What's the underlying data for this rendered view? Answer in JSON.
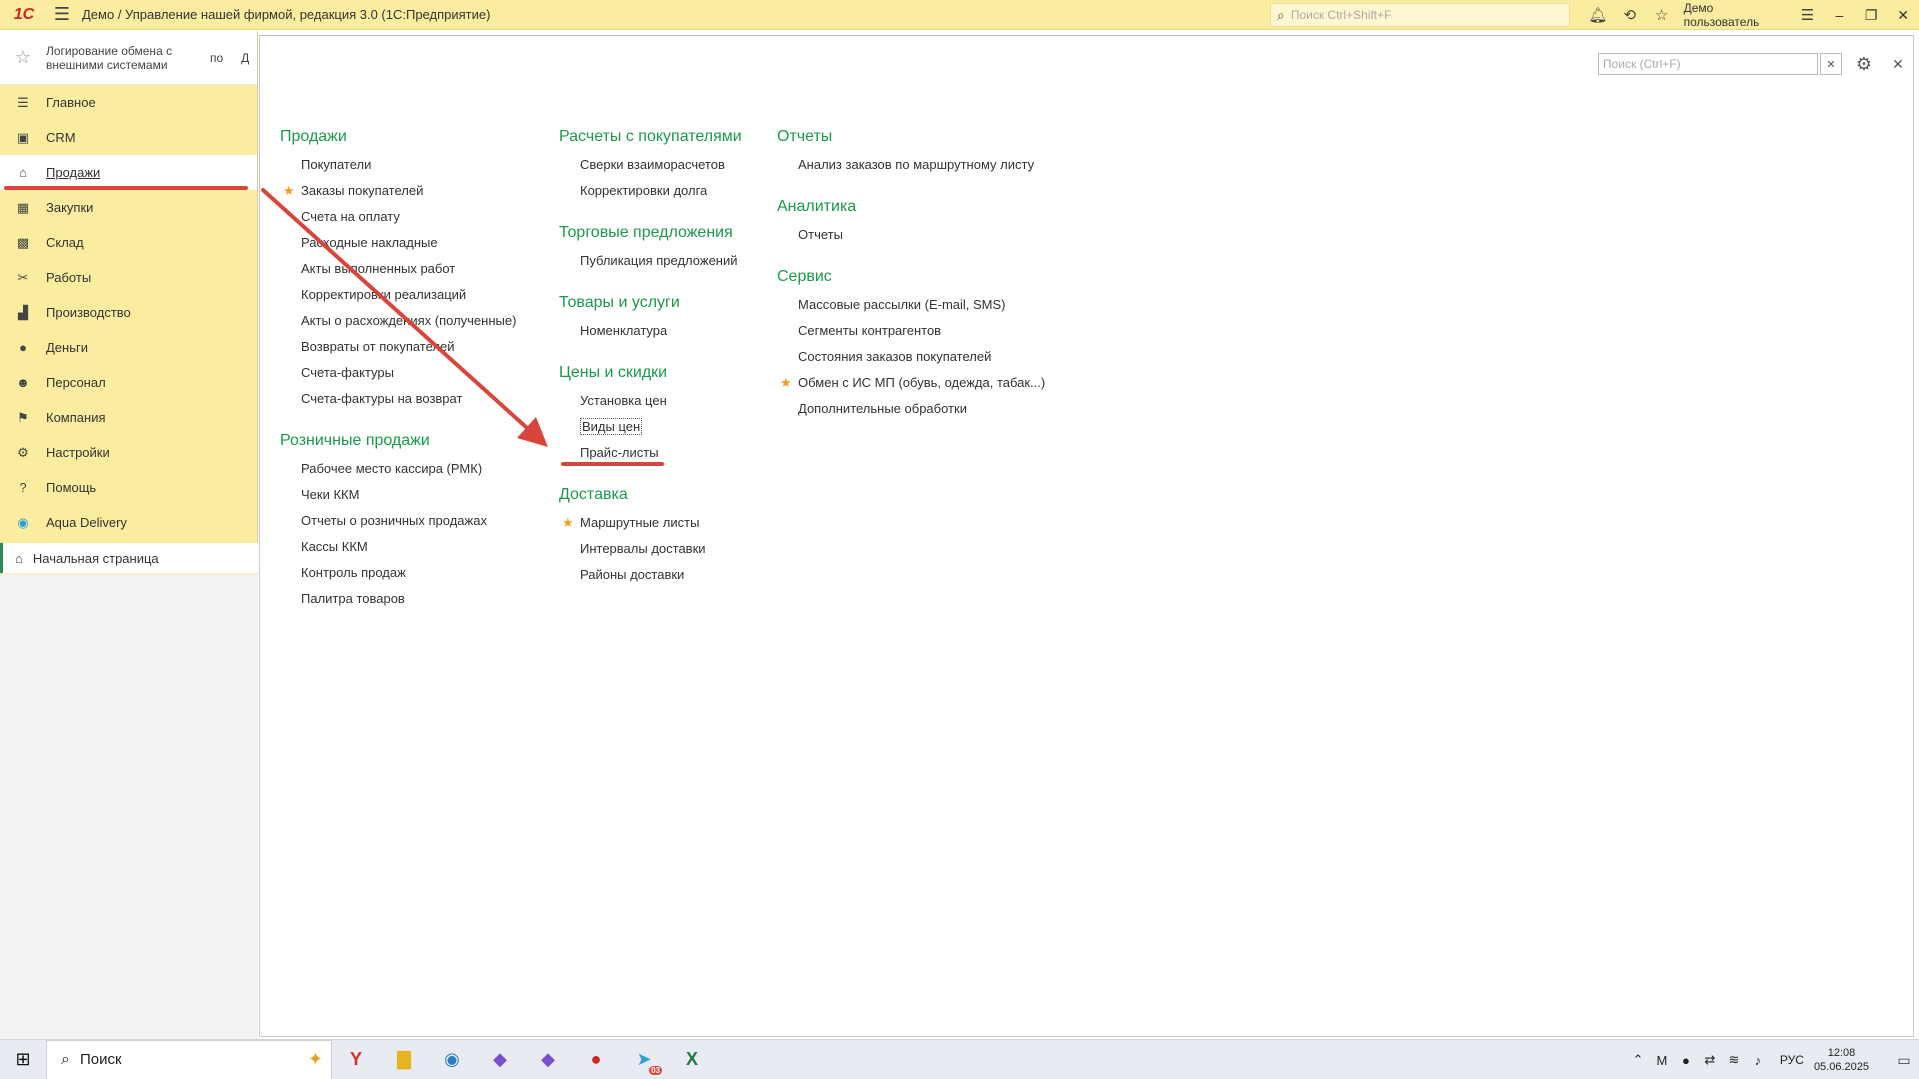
{
  "titlebar": {
    "title": "Демо / Управление нашей фирмой, редакция 3.0  (1С:Предприятие)",
    "search_placeholder": "Поиск Ctrl+Shift+F",
    "user": "Демо пользователь",
    "logo": "1С"
  },
  "favorites": {
    "item1": "Логирование обмена с внешними системами",
    "item2": "по",
    "item3": "Д"
  },
  "sidebar": {
    "items": [
      {
        "label": "Главное",
        "icon": "list-icon"
      },
      {
        "label": "CRM",
        "icon": "crm-icon"
      },
      {
        "label": "Продажи",
        "icon": "basket-icon"
      },
      {
        "label": "Закупки",
        "icon": "purchase-icon"
      },
      {
        "label": "Склад",
        "icon": "warehouse-icon"
      },
      {
        "label": "Работы",
        "icon": "tools-icon"
      },
      {
        "label": "Производство",
        "icon": "factory-icon"
      },
      {
        "label": "Деньги",
        "icon": "money-icon"
      },
      {
        "label": "Персонал",
        "icon": "people-icon"
      },
      {
        "label": "Компания",
        "icon": "flag-icon"
      },
      {
        "label": "Настройки",
        "icon": "gear-icon"
      },
      {
        "label": "Помощь",
        "icon": "help-icon"
      },
      {
        "label": "Aqua Delivery",
        "icon": "location-icon"
      }
    ],
    "home": "Начальная страница"
  },
  "main": {
    "search_placeholder": "Поиск (Ctrl+F)",
    "columns": [
      [
        {
          "title": "Продажи",
          "links": [
            {
              "label": "Покупатели",
              "fav": false
            },
            {
              "label": "Заказы покупателей",
              "fav": true
            },
            {
              "label": "Счета на оплату",
              "fav": false
            },
            {
              "label": "Расходные накладные",
              "fav": false
            },
            {
              "label": "Акты выполненных работ",
              "fav": false
            },
            {
              "label": "Корректировки реализаций",
              "fav": false
            },
            {
              "label": "Акты о расхождениях (полученные)",
              "fav": false
            },
            {
              "label": "Возвраты от покупателей",
              "fav": false
            },
            {
              "label": "Счета-фактуры",
              "fav": false
            },
            {
              "label": "Счета-фактуры на возврат",
              "fav": false
            }
          ]
        },
        {
          "title": "Розничные продажи",
          "links": [
            {
              "label": "Рабочее место кассира (РМК)",
              "fav": false
            },
            {
              "label": "Чеки ККМ",
              "fav": false
            },
            {
              "label": "Отчеты о розничных продажах",
              "fav": false
            },
            {
              "label": "Кассы ККМ",
              "fav": false
            },
            {
              "label": "Контроль продаж",
              "fav": false
            },
            {
              "label": "Палитра товаров",
              "fav": false
            }
          ]
        }
      ],
      [
        {
          "title": "Расчеты с покупателями",
          "links": [
            {
              "label": "Сверки взаиморасчетов",
              "fav": false
            },
            {
              "label": "Корректировки долга",
              "fav": false
            }
          ]
        },
        {
          "title": "Торговые предложения",
          "links": [
            {
              "label": "Публикация предложений",
              "fav": false
            }
          ]
        },
        {
          "title": "Товары и услуги",
          "links": [
            {
              "label": "Номенклатура",
              "fav": false
            }
          ]
        },
        {
          "title": "Цены и скидки",
          "links": [
            {
              "label": "Установка цен",
              "fav": false
            },
            {
              "label": "Виды цен",
              "fav": false
            },
            {
              "label": "Прайс-листы",
              "fav": false
            }
          ]
        },
        {
          "title": "Доставка",
          "links": [
            {
              "label": "Маршрутные листы",
              "fav": true
            },
            {
              "label": "Интервалы доставки",
              "fav": false
            },
            {
              "label": "Районы доставки",
              "fav": false
            }
          ]
        }
      ],
      [
        {
          "title": "Отчеты",
          "links": [
            {
              "label": "Анализ заказов по маршрутному листу",
              "fav": false
            }
          ]
        },
        {
          "title": "Аналитика",
          "links": [
            {
              "label": "Отчеты",
              "fav": false
            }
          ]
        },
        {
          "title": "Сервис",
          "links": [
            {
              "label": "Массовые рассылки (E-mail, SMS)",
              "fav": false
            },
            {
              "label": "Сегменты контрагентов",
              "fav": false
            },
            {
              "label": "Состояния заказов покупателей",
              "fav": false
            },
            {
              "label": "Обмен с ИС МП (обувь, одежда, табак...)",
              "fav": true
            },
            {
              "label": "Дополнительные обработки",
              "fav": false
            }
          ]
        }
      ]
    ]
  },
  "taskbar": {
    "search_label": "Поиск",
    "lang": "РУС",
    "time": "12:08",
    "date": "05.06.2025",
    "telegram_badge": "03"
  },
  "colors": {
    "sidebar_bg": "#fbeda0",
    "section_title": "#1a9a4a",
    "annotation_red": "#d9453a",
    "fav_star": "#f0a020"
  }
}
